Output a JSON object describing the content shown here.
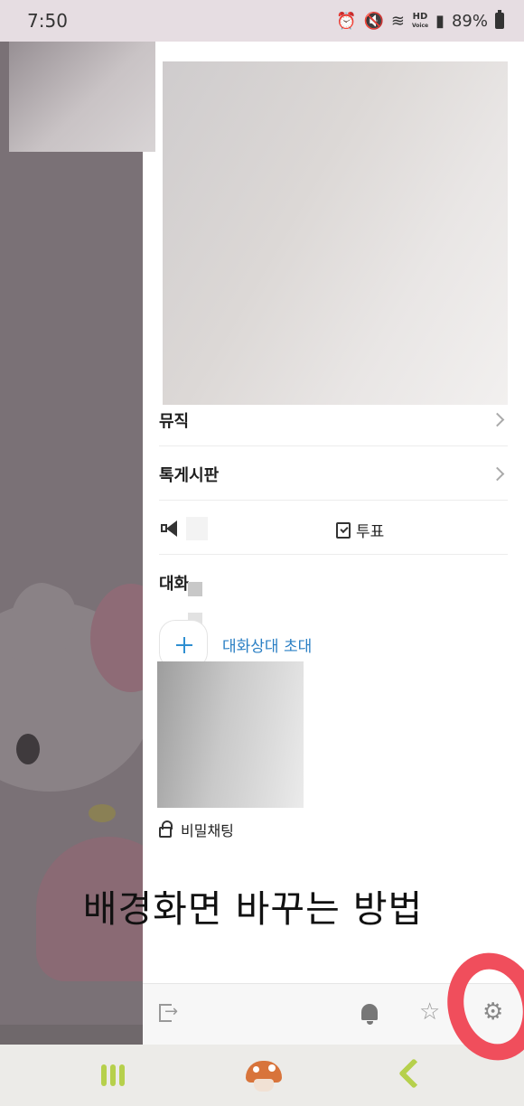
{
  "status_bar": {
    "time": "7:50",
    "battery": "89%",
    "hd_label": "HD",
    "voice_label": "Voice"
  },
  "drawer": {
    "menu": [
      {
        "label": "뮤직"
      },
      {
        "label": "톡게시판"
      }
    ],
    "actions": {
      "vote_label": "투표"
    },
    "members": {
      "heading": "대화",
      "invite_label": "대화상대 초대"
    },
    "secret_chat_label": "비밀채팅"
  },
  "caption": "배경화면 바꾸는 방법",
  "colors": {
    "accent_blue": "#2a7fc4",
    "annotation_red": "#f04e5c",
    "nav_green": "#b6d04c"
  }
}
